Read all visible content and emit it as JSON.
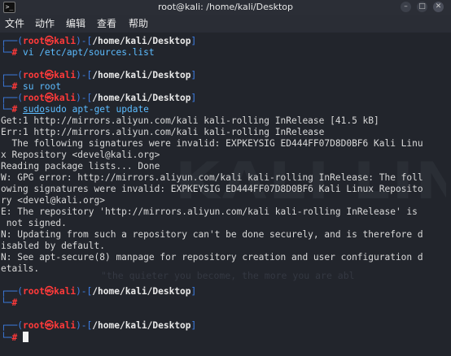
{
  "window": {
    "title": "root@kali: /home/kali/Desktop",
    "app_icon": "terminal-icon",
    "buttons": {
      "minimize": "–",
      "maximize": "□",
      "close": "✕"
    }
  },
  "menu": [
    "文件",
    "动作",
    "编辑",
    "查看",
    "帮助"
  ],
  "prompt": {
    "user": "root",
    "at": "㉿",
    "host": "kali",
    "path": "/home/kali/Desktop",
    "symbol": "#"
  },
  "commands": {
    "c1": "vi /etc/apt/sources.list",
    "c2": "su root",
    "c3a": "sudo",
    "c3b": "sudo",
    "c3c": " apt-get update"
  },
  "output": [
    "Get:1 http://mirrors.aliyun.com/kali kali-rolling InRelease [41.5 kB]",
    "Err:1 http://mirrors.aliyun.com/kali kali-rolling InRelease",
    "  The following signatures were invalid: EXPKEYSIG ED444FF07D8D0BF6 Kali Linu",
    "x Repository <devel@kali.org>",
    "Reading package lists... Done",
    "W: GPG error: http://mirrors.aliyun.com/kali kali-rolling InRelease: The foll",
    "owing signatures were invalid: EXPKEYSIG ED444FF07D8D0BF6 Kali Linux Reposito",
    "ry <devel@kali.org>",
    "E: The repository 'http://mirrors.aliyun.com/kali kali-rolling InRelease' is",
    " not signed.",
    "N: Updating from such a repository can't be done securely, and is therefore d",
    "isabled by default.",
    "N: See apt-secure(8) manpage for repository creation and user configuration d",
    "etails."
  ],
  "watermark": {
    "logo": "KALI LINUX",
    "quote": "\"the quieter you become, the more you are abl"
  },
  "colors": {
    "prompt_frame": "#3d7fe6",
    "prompt_user": "#ff3a3a",
    "command": "#5cbcff",
    "background": "#22252c"
  }
}
